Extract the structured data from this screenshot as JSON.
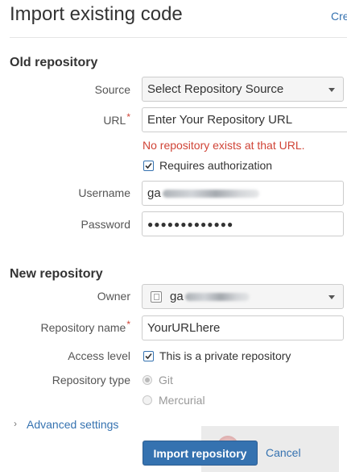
{
  "header": {
    "title": "Import existing code",
    "right_link": "Cre"
  },
  "old_repository": {
    "heading": "Old repository",
    "source": {
      "label": "Source",
      "value": "Select Repository Source",
      "icon": "chevron-down-icon"
    },
    "url": {
      "label": "URL",
      "required_mark": "*",
      "value": "Enter Your Repository URL"
    },
    "error": "No repository exists at that URL.",
    "requires_auth": {
      "label": "Requires authorization",
      "checked": true
    },
    "username": {
      "label": "Username",
      "visible_prefix": "ga"
    },
    "password": {
      "label": "Password",
      "value": "●●●●●●●●●●●●●"
    }
  },
  "new_repository": {
    "heading": "New repository",
    "owner": {
      "label": "Owner",
      "visible_prefix": "ga",
      "icon": "avatar-icon"
    },
    "repo_name": {
      "label": "Repository name",
      "required_mark": "*",
      "value": "YourURLhere"
    },
    "access_level": {
      "label": "Access level",
      "checkbox_label": "This is a private repository",
      "checked": true
    },
    "repo_type": {
      "label": "Repository type",
      "options": [
        "Git",
        "Mercurial"
      ],
      "selected": "Git"
    }
  },
  "advanced": {
    "label": "Advanced settings",
    "icon": "chevron-right-icon"
  },
  "actions": {
    "import_label": "Import repository",
    "cancel_label": "Cancel"
  },
  "colors": {
    "link": "#3572b0",
    "error": "#d04437",
    "primary_button": "#3572b0"
  }
}
